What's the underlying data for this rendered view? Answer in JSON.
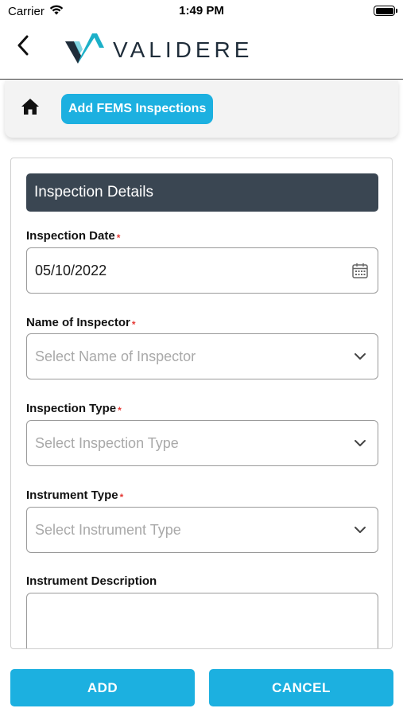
{
  "status_bar": {
    "carrier": "Carrier",
    "time": "1:49 PM"
  },
  "nav": {
    "brand": "VALIDERE"
  },
  "breadcrumb": {
    "current": "Add FEMS Inspections"
  },
  "form": {
    "section_title": "Inspection Details",
    "fields": [
      {
        "label": "Inspection Date",
        "required": true,
        "value": "05/10/2022",
        "placeholder": "",
        "icon": "calendar-icon"
      },
      {
        "label": "Name of Inspector",
        "required": true,
        "value": "",
        "placeholder": "Select Name of Inspector",
        "icon": "chevron-down-icon"
      },
      {
        "label": "Inspection Type",
        "required": true,
        "value": "",
        "placeholder": "Select Inspection Type",
        "icon": "chevron-down-icon"
      },
      {
        "label": "Instrument Type",
        "required": true,
        "value": "",
        "placeholder": "Select Instrument Type",
        "icon": "chevron-down-icon"
      },
      {
        "label": "Instrument Description",
        "required": false,
        "value": "",
        "placeholder": ""
      }
    ],
    "required_mark": "*"
  },
  "actions": {
    "add_label": "ADD",
    "cancel_label": "CANCEL"
  },
  "colors": {
    "accent": "#1cb0e0",
    "section_header_bg": "#3a4652",
    "required": "#e53935",
    "logo_teal": "#1cb0c8",
    "logo_dark": "#1f2d3a"
  }
}
